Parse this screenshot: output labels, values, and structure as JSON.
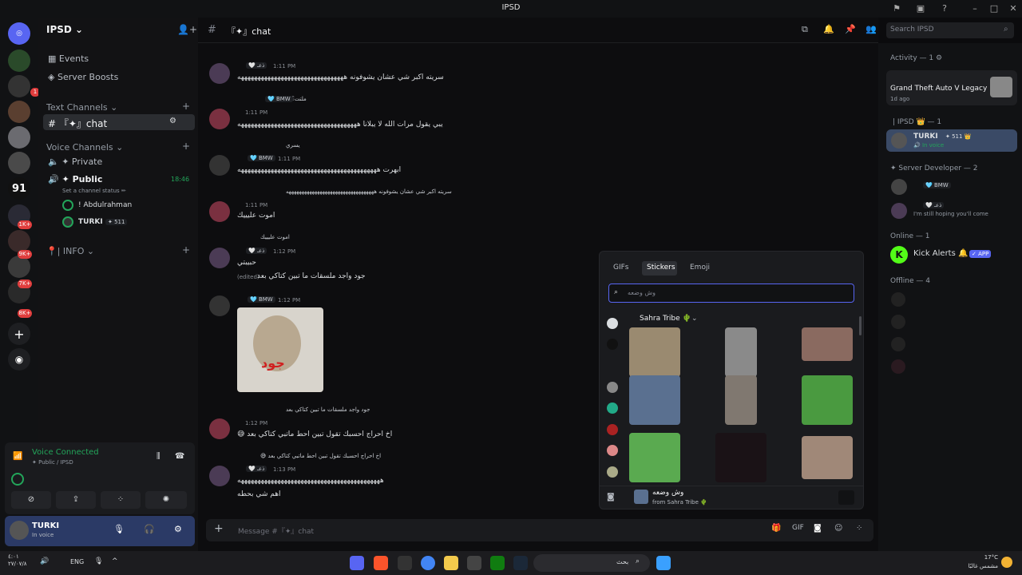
{
  "window": {
    "title": "IPSD"
  },
  "rail": {
    "badges": [
      "1",
      "1K+",
      "9K+",
      "7K+",
      "8K+"
    ],
    "server_label": "91"
  },
  "server": {
    "name": "IPSD"
  },
  "sidebar": {
    "events": "Events",
    "boosts": "Server Boosts",
    "text_channels": "Text Channels",
    "chat_channel": "『✦』chat",
    "voice_channels": "Voice Channels",
    "private": "✦ Private",
    "public": "✦ Public",
    "public_time": "18:46",
    "status_hint": "Set a channel status ✏",
    "voice_users": [
      "! Abdulrahman",
      "TURKI"
    ],
    "turki_tag": "✦ 511",
    "info": "📍| INFO"
  },
  "voice": {
    "status": "Voice Connected",
    "sub": "✦ Public / IPSD"
  },
  "user": {
    "name": "TURKI",
    "status": "In voice"
  },
  "header": {
    "channel": "『✦』chat"
  },
  "search": {
    "placeholder": "Search IPSD"
  },
  "messages": [
    {
      "name": "",
      "tag": "🤍 ذعـ",
      "time": "1:11 PM",
      "text": "سريته اكبر شي عشان يشوفونه ههههههههههههههههههههههههههههههههه"
    },
    {
      "name": "",
      "reply": "ملتت؟",
      "tag": "🩵 BMW",
      "time": "1:11 PM",
      "text": "يبي يقول مرات الله لا يبلانا ههههههههههههههههههههههههههههههههههههه"
    },
    {
      "name": "",
      "reply": "يسري",
      "tag": "🩵 BMW",
      "time": "1:11 PM",
      "text": "ابهرت ههههههههههههههههههههههههههههههههههههههههههه"
    },
    {
      "name": "",
      "reply": "سريته اكبر شي عشان يشوفونه ههههههههههههههههههههههههههههههههههه",
      "tag": "🤍",
      "time": "1:11 PM",
      "text": "اموت عليييك"
    },
    {
      "name": "",
      "reply": "اموت عليييك",
      "tag": "🤍 ذعـ",
      "time": "1:12 PM",
      "text": "حبيبتي",
      "extra": "جود واجد ملسقات ما تبين كتاكي بعد",
      "edited": "(edited)"
    },
    {
      "name": "",
      "tag": "🩵 BMW",
      "time": "1:12 PM",
      "text": ""
    },
    {
      "name": "",
      "reply": "جود واجد ملسقات ما تبين كتاكي بعد",
      "tag": "🤍",
      "time": "1:12 PM",
      "text": "😅 اخ احراج احسبك تقول تبين احط ماتبي كتاكي بعد"
    },
    {
      "name": "",
      "reply": "😅 اخ احراج احسبك تقول تبين احط ماتبي كتاكي بعد",
      "tag": "🤍 ذعـ",
      "time": "1:13 PM",
      "text": "هههههههههههههههههههههههههههههههههههههههههههه",
      "extra": "اهم شي بحطه"
    }
  ],
  "sticker_image_text": "جود",
  "composer": {
    "placeholder": "Message #『✦』chat"
  },
  "picker": {
    "tabs": [
      "GIFs",
      "Stickers",
      "Emoji"
    ],
    "active_tab": "Stickers",
    "search_value": "وش وضعه",
    "pack": "Sahra Tribe 🌵",
    "preview_name": "وش وضعه",
    "preview_from": "from Sahra Tribe 🌵"
  },
  "members": {
    "activity_header": "Activity — 1 ⚙",
    "activity_game": "Grand Theft Auto V Legacy",
    "activity_time": "1d ago",
    "role1": "| IPSD 👑 — 1",
    "role1_user": "TURKI",
    "role1_tag": "✦ 511 👑",
    "role1_status": "🔊 In voice",
    "role2": "✦ Server Developer — 2",
    "bmw": "🩵 BMW",
    "dhaa": "🤍 ذعـ",
    "dhaa_status": "I'm still hoping you'll come",
    "online": "Online — 1",
    "kick": "Kick Alerts 🔔",
    "app": "✓ APP",
    "offline": "Offline — 4"
  },
  "taskbar": {
    "lang": "ENG",
    "search": "بحث",
    "temp": "17°C",
    "weather": "مشمس غالبًا",
    "time": "٤:٠١",
    "date": "٢٧/٠٧/٨"
  },
  "colors": {
    "accent": "#5865f2",
    "online": "#23a55a",
    "bg": "#0d0d0f",
    "sidebar": "#121214"
  }
}
